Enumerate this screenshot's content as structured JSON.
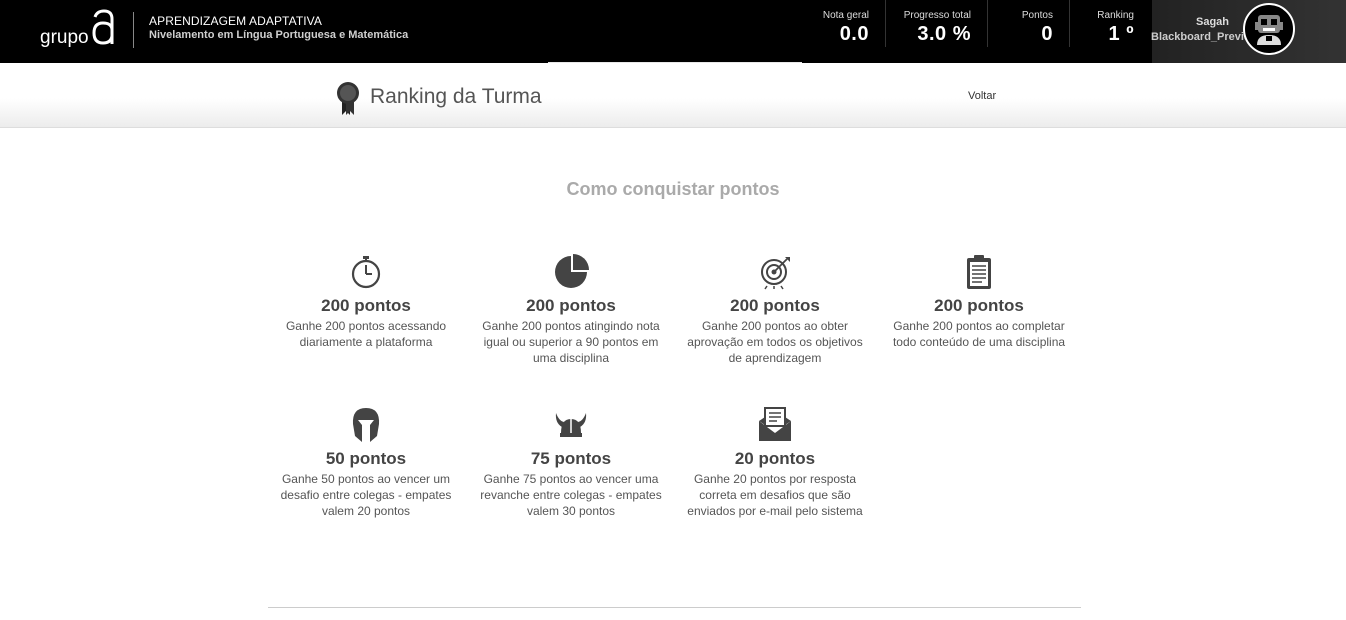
{
  "header": {
    "logo_text": "grupo",
    "logo_letter": "a",
    "app_title": "APRENDIZAGEM ADAPTATIVA",
    "app_subtitle": "Nivelamento em Língua Portuguesa e Matemática",
    "stats": [
      {
        "label": "Nota geral",
        "value": "0.0"
      },
      {
        "label": "Progresso total",
        "value": "3.0 %"
      },
      {
        "label": "Pontos",
        "value": "0"
      },
      {
        "label": "Ranking",
        "value": "1 º"
      }
    ],
    "user": {
      "name": "Sagah",
      "subtitle": "Blackboard_Preview"
    }
  },
  "subheader": {
    "title": "Ranking da Turma",
    "back_label": "Voltar"
  },
  "main": {
    "section_title": "Como conquistar pontos",
    "cards": [
      {
        "icon": "stopwatch-icon",
        "points": "200 pontos",
        "description": "Ganhe 200 pontos acessando diariamente a plataforma"
      },
      {
        "icon": "pie-chart-icon",
        "points": "200 pontos",
        "description": "Ganhe 200 pontos atingindo nota igual ou superior a 90 pontos em uma disciplina"
      },
      {
        "icon": "target-icon",
        "points": "200 pontos",
        "description": "Ganhe 200 pontos ao obter aprovação em todos os objetivos de aprendizagem"
      },
      {
        "icon": "clipboard-icon",
        "points": "200 pontos",
        "description": "Ganhe 200 pontos ao completar todo conteúdo de uma disciplina"
      },
      {
        "icon": "spartan-helmet-icon",
        "points": "50 pontos",
        "description": "Ganhe 50 pontos ao vencer um desafio entre colegas - empates valem 20 pontos"
      },
      {
        "icon": "viking-helmet-icon",
        "points": "75 pontos",
        "description": "Ganhe 75 pontos ao vencer uma revanche entre colegas - empates valem 30 pontos"
      },
      {
        "icon": "envelope-icon",
        "points": "20 pontos",
        "description": "Ganhe 20 pontos por resposta correta em desafios que são enviados por e-mail pelo sistema"
      }
    ]
  }
}
